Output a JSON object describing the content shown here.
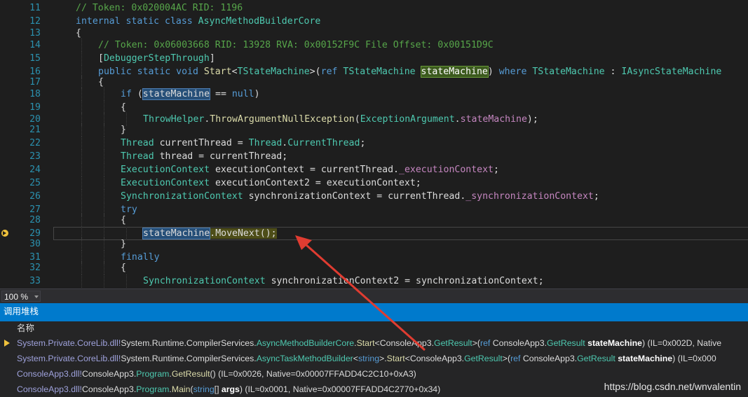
{
  "editor": {
    "lines": [
      {
        "n": "11",
        "segs": [
          [
            "cm",
            "// Token: 0x020004AC RID: 1196"
          ]
        ]
      },
      {
        "n": "12",
        "segs": [
          [
            "kw",
            "internal static class "
          ],
          [
            "ty",
            "AsyncMethodBuilderCore"
          ]
        ]
      },
      {
        "n": "13",
        "segs": [
          [
            "pl",
            "{"
          ]
        ]
      },
      {
        "n": "14",
        "segs": [
          [
            "cm",
            "// Token: 0x06003668 RID: 13928 RVA: 0x00152F9C File Offset: 0x00151D9C"
          ]
        ]
      },
      {
        "n": "15",
        "segs": [
          [
            "pl",
            "["
          ],
          [
            "ty",
            "DebuggerStepThrough"
          ],
          [
            "pl",
            "]"
          ]
        ]
      },
      {
        "n": "16",
        "segs": [
          [
            "kw",
            "public static void "
          ],
          [
            "mt",
            "Start"
          ],
          [
            "pl",
            "<"
          ],
          [
            "ty",
            "TStateMachine"
          ],
          [
            "pl",
            ">("
          ],
          [
            "kw",
            "ref "
          ],
          [
            "ty",
            "TStateMachine "
          ],
          [
            "hlg",
            "stateMachine"
          ],
          [
            "pl",
            ") "
          ],
          [
            "kw",
            "where "
          ],
          [
            "ty",
            "TStateMachine"
          ],
          [
            "pl",
            " : "
          ],
          [
            "ty",
            "IAsyncStateMachine"
          ]
        ]
      },
      {
        "n": "17",
        "segs": [
          [
            "pl",
            "{"
          ]
        ]
      },
      {
        "n": "18",
        "segs": [
          [
            "kw",
            "if "
          ],
          [
            "pl",
            "("
          ],
          [
            "hl",
            "stateMachine"
          ],
          [
            "pl",
            " == "
          ],
          [
            "kw",
            "null"
          ],
          [
            "pl",
            ")"
          ]
        ]
      },
      {
        "n": "19",
        "segs": [
          [
            "pl",
            "{"
          ]
        ]
      },
      {
        "n": "20",
        "segs": [
          [
            "ty",
            "ThrowHelper"
          ],
          [
            "pl",
            "."
          ],
          [
            "mt",
            "ThrowArgumentNullException"
          ],
          [
            "pl",
            "("
          ],
          [
            "ty",
            "ExceptionArgument"
          ],
          [
            "pl",
            "."
          ],
          [
            "fd",
            "stateMachine"
          ],
          [
            "pl",
            ");"
          ]
        ]
      },
      {
        "n": "21",
        "segs": [
          [
            "pl",
            "}"
          ]
        ]
      },
      {
        "n": "22",
        "segs": [
          [
            "ty",
            "Thread"
          ],
          [
            "pl",
            " currentThread = "
          ],
          [
            "ty",
            "Thread"
          ],
          [
            "pl",
            "."
          ],
          [
            "ty",
            "CurrentThread"
          ],
          [
            "pl",
            ";"
          ]
        ]
      },
      {
        "n": "23",
        "segs": [
          [
            "ty",
            "Thread"
          ],
          [
            "pl",
            " thread = currentThread;"
          ]
        ]
      },
      {
        "n": "24",
        "segs": [
          [
            "ty",
            "ExecutionContext"
          ],
          [
            "pl",
            " executionContext = currentThread."
          ],
          [
            "fd",
            "_executionContext"
          ],
          [
            "pl",
            ";"
          ]
        ]
      },
      {
        "n": "25",
        "segs": [
          [
            "ty",
            "ExecutionContext"
          ],
          [
            "pl",
            " executionContext2 = executionContext;"
          ]
        ]
      },
      {
        "n": "26",
        "segs": [
          [
            "ty",
            "SynchronizationContext"
          ],
          [
            "pl",
            " synchronizationContext = currentThread."
          ],
          [
            "fd",
            "_synchronizationContext"
          ],
          [
            "pl",
            ";"
          ]
        ]
      },
      {
        "n": "27",
        "segs": [
          [
            "kw",
            "try"
          ]
        ]
      },
      {
        "n": "28",
        "segs": [
          [
            "pl",
            "{"
          ]
        ]
      },
      {
        "n": "29",
        "segs": [
          [
            "hl",
            "stateMachine"
          ],
          [
            "hly",
            "."
          ],
          [
            "hly",
            "MoveNext();"
          ]
        ],
        "current": true
      },
      {
        "n": "30",
        "segs": [
          [
            "pl",
            "}"
          ]
        ]
      },
      {
        "n": "31",
        "segs": [
          [
            "kw",
            "finally"
          ]
        ]
      },
      {
        "n": "32",
        "segs": [
          [
            "pl",
            "{"
          ]
        ]
      },
      {
        "n": "33",
        "segs": [
          [
            "ty",
            "SynchronizationContext"
          ],
          [
            "pl",
            " synchronizationContext2 = synchronizationContext;"
          ]
        ]
      }
    ]
  },
  "zoom": {
    "value": "100 %"
  },
  "call_stack": {
    "title": "调用堆栈",
    "column": "名称",
    "rows": [
      {
        "current": true,
        "segs": [
          [
            "mod",
            "System.Private.CoreLib.dll!"
          ],
          [
            "pl",
            "System.Runtime.CompilerServices."
          ],
          [
            "ty",
            "AsyncMethodBuilderCore"
          ],
          [
            "pl",
            "."
          ],
          [
            "mt",
            "Start"
          ],
          [
            "pl",
            "<"
          ],
          [
            "pl",
            "ConsoleApp3."
          ],
          [
            "ty",
            "GetResult"
          ],
          [
            "pl",
            ">("
          ],
          [
            "kw",
            "ref "
          ],
          [
            "pl",
            "ConsoleApp3."
          ],
          [
            "ty",
            "GetResult "
          ],
          [
            "pm",
            "stateMachine"
          ],
          [
            "pl",
            ") (IL=0x002D, Native"
          ]
        ]
      },
      {
        "current": false,
        "segs": [
          [
            "mod",
            "System.Private.CoreLib.dll!"
          ],
          [
            "pl",
            "System.Runtime.CompilerServices."
          ],
          [
            "ty",
            "AsyncTaskMethodBuilder"
          ],
          [
            "pl",
            "<"
          ],
          [
            "kw",
            "string"
          ],
          [
            "pl",
            ">."
          ],
          [
            "mt",
            "Start"
          ],
          [
            "pl",
            "<"
          ],
          [
            "pl",
            "ConsoleApp3."
          ],
          [
            "ty",
            "GetResult"
          ],
          [
            "pl",
            ">("
          ],
          [
            "kw",
            "ref "
          ],
          [
            "pl",
            "ConsoleApp3."
          ],
          [
            "ty",
            "GetResult "
          ],
          [
            "pm",
            "stateMachine"
          ],
          [
            "pl",
            ") (IL=0x000"
          ]
        ]
      },
      {
        "current": false,
        "segs": [
          [
            "mod",
            "ConsoleApp3.dll!"
          ],
          [
            "pl",
            "ConsoleApp3."
          ],
          [
            "ty",
            "Program"
          ],
          [
            "pl",
            "."
          ],
          [
            "mt",
            "GetResult"
          ],
          [
            "pl",
            "() (IL=0x0026, Native=0x00007FFADD4C2C10+0xA3)"
          ]
        ]
      },
      {
        "current": false,
        "segs": [
          [
            "mod",
            "ConsoleApp3.dll!"
          ],
          [
            "pl",
            "ConsoleApp3."
          ],
          [
            "ty",
            "Program"
          ],
          [
            "pl",
            "."
          ],
          [
            "mt",
            "Main"
          ],
          [
            "pl",
            "("
          ],
          [
            "kw",
            "string"
          ],
          [
            "pl",
            "[] "
          ],
          [
            "pm",
            "args"
          ],
          [
            "pl",
            ") (IL≈0x0001, Native=0x00007FFADD4C2770+0x34)"
          ]
        ]
      }
    ]
  },
  "watermark": "https://blog.csdn.net/wnvalentin",
  "colors": {
    "accent": "#007acc",
    "annotation_arrow": "#e03c31",
    "current_line_arrow": "#f0c23c"
  }
}
